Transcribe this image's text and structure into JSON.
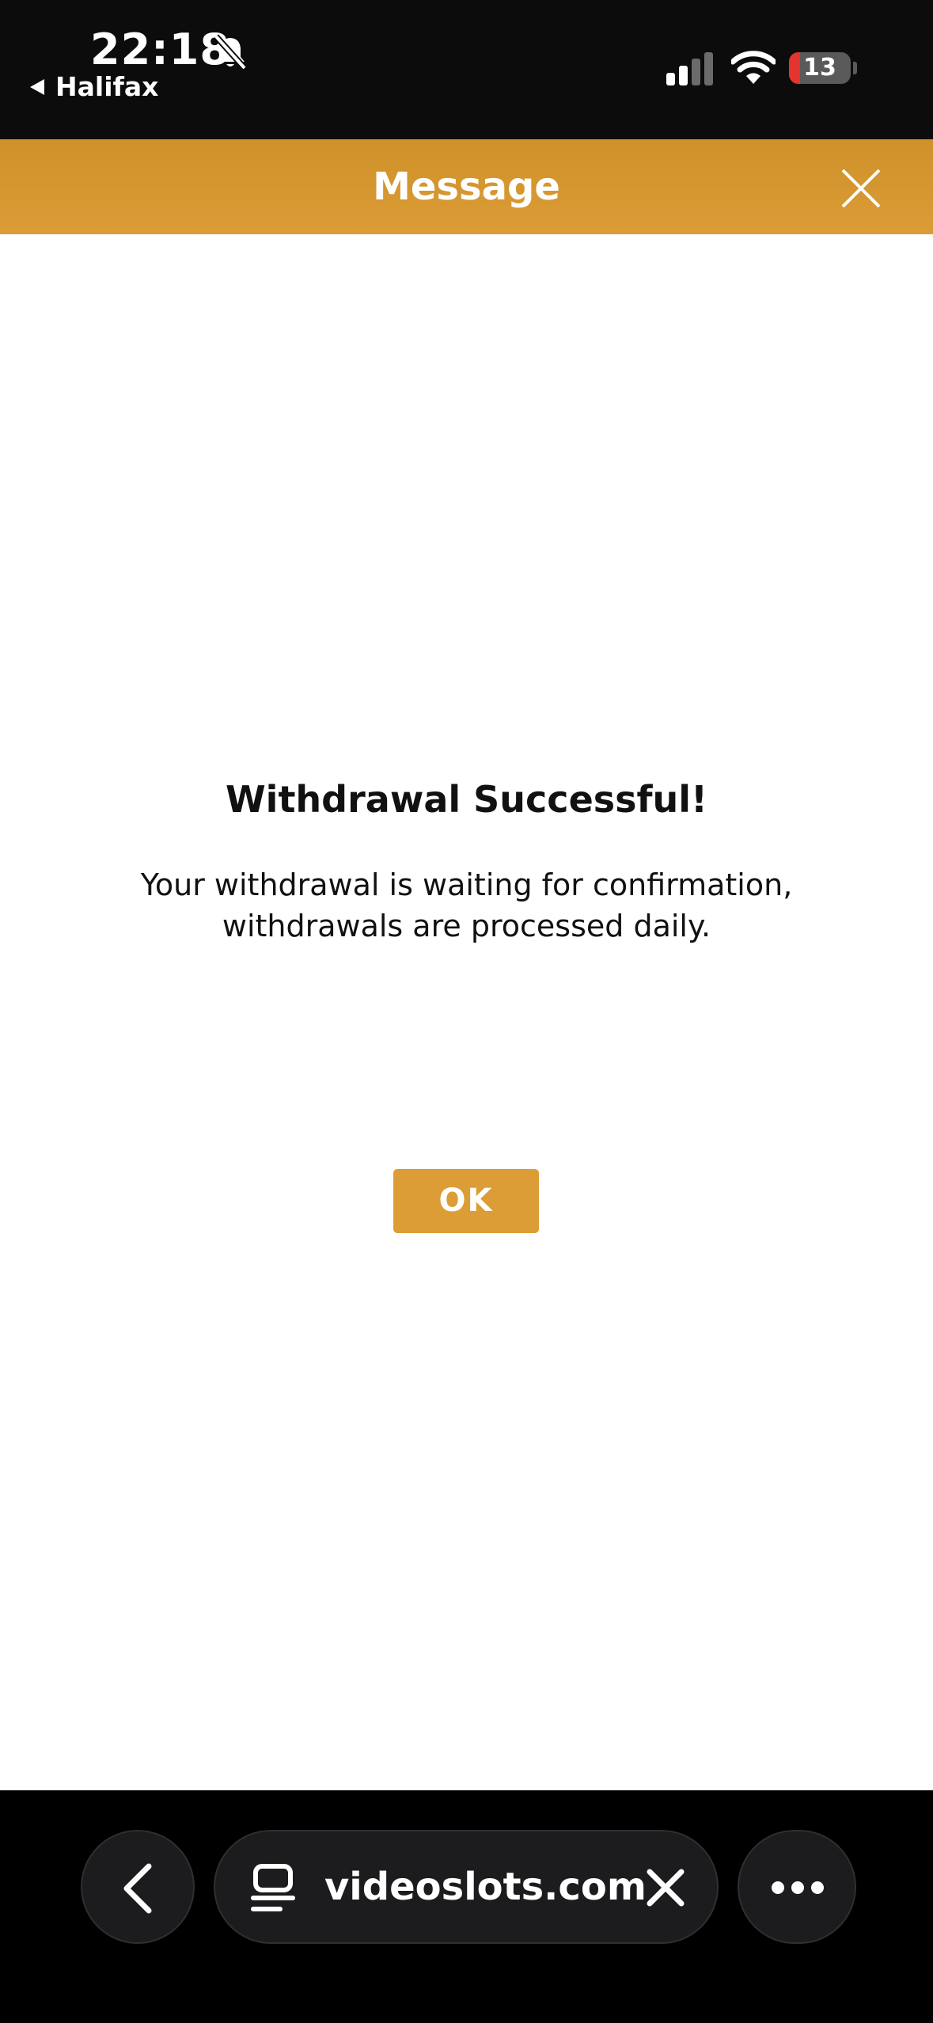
{
  "status_bar": {
    "time": "22:18",
    "back_app": "Halifax",
    "battery_level": "13",
    "icons": [
      "bell-slash-icon",
      "cellular-signal-icon",
      "wifi-icon",
      "battery-icon"
    ]
  },
  "header": {
    "title": "Message",
    "close_icon": "close-icon",
    "color": "#dd9d36"
  },
  "dialog": {
    "title": "Withdrawal Successful!",
    "body_line1": "Your withdrawal is waiting for confirmation,",
    "body_line2": "withdrawals are processed daily.",
    "ok_label": "OK"
  },
  "toolbar": {
    "url": "videoslots.com",
    "icons": [
      "chevron-left-icon",
      "tab-icon",
      "clear-icon",
      "more-icon"
    ]
  }
}
